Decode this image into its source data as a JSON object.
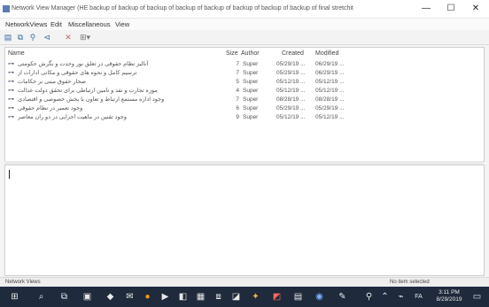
{
  "window": {
    "title": "Network View Manager (HE backup of backup of backup of backup of backup of backup of backup of backup of final stretchit",
    "minimize_label": "—",
    "maximize_label": "☐",
    "close_label": "✕"
  },
  "menubar": {
    "items": [
      "NetworkViews",
      "Edit",
      "Miscellaneous",
      "View"
    ]
  },
  "toolbar": {
    "icons": [
      "new-view-icon",
      "copy-view-icon",
      "link-icon",
      "network-icon",
      "delete-icon",
      "grid-dropdown-icon"
    ]
  },
  "list": {
    "headers": {
      "name": "Name",
      "size": "Size",
      "author": "Author",
      "created": "Created",
      "modified": "Modified"
    },
    "rows": [
      {
        "name": "آنالیز نظام حقوقی در تعلق نور وحدت و نگرش حکومتی",
        "size": "7",
        "author": "Super",
        "created": "05/29/19 ...",
        "modified": "06/29/19 ..."
      },
      {
        "name": "ترسیم کامل و نحوه های حقوقی و مکانی ادارات از",
        "size": "7",
        "author": "Super",
        "created": "05/29/19 ...",
        "modified": "06/29/19 ..."
      },
      {
        "name": "صحار حقوق مبنی بر حکامات",
        "size": "5",
        "author": "Super",
        "created": "05/12/19 ...",
        "modified": "05/12/19 ..."
      },
      {
        "name": "موزه تجارت و نقد و تامین ارتباطی برای تحقق دولت عدالت",
        "size": "4",
        "author": "Super",
        "created": "05/12/19 ...",
        "modified": "05/12/19 ..."
      },
      {
        "name": "وجود اداره مستمع ارتباط و تعاون با بخش خصوصی و اقتصادی",
        "size": "7",
        "author": "Super",
        "created": "08/28/19 ...",
        "modified": "08/28/19 ..."
      },
      {
        "name": "وجود تعمیر در نظام حقوقی",
        "size": "6",
        "author": "Super",
        "created": "05/29/19 ...",
        "modified": "05/29/19 ..."
      },
      {
        "name": "وجود تقنین در ماهیت اجرایی در دو ران معاصر",
        "size": "9",
        "author": "Super",
        "created": "05/12/19 ...",
        "modified": "05/12/19 ..."
      }
    ]
  },
  "statusbar": {
    "left": "Network Views",
    "right": "No item selected"
  },
  "taskbar": {
    "time": "3:11 PM",
    "date": "8/29/2019",
    "lang": "FA"
  }
}
